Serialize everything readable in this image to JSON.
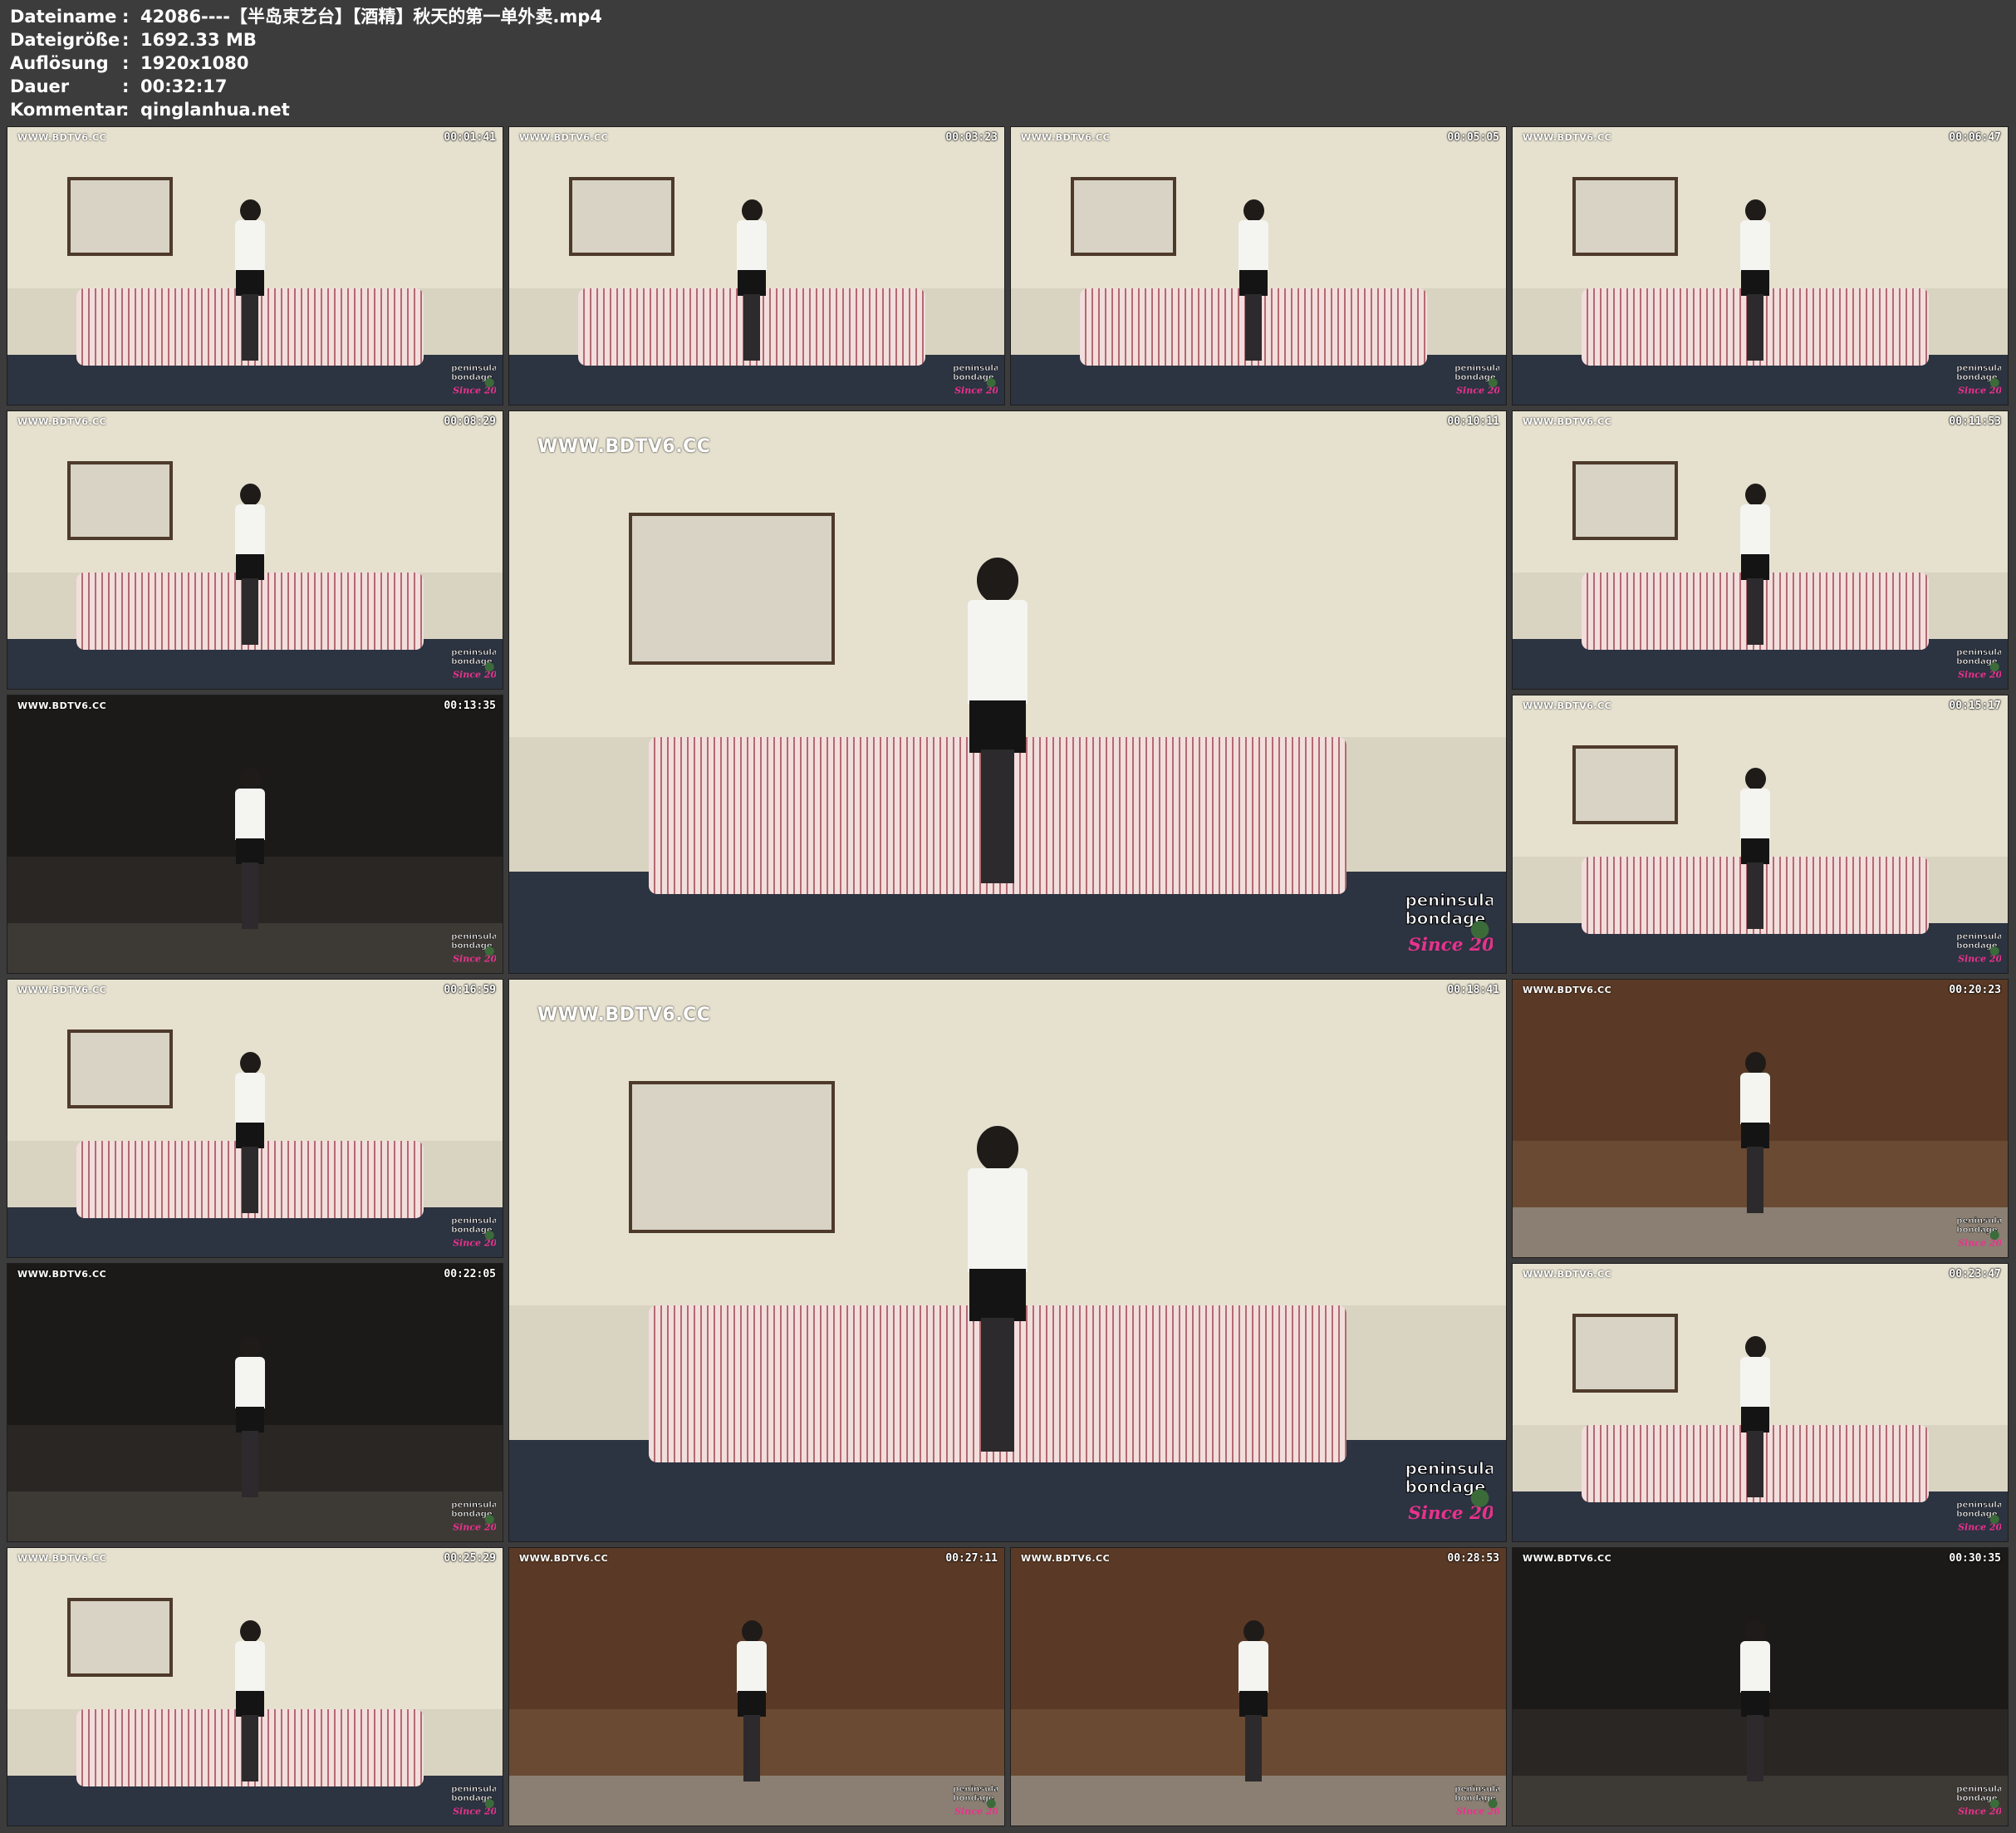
{
  "info": {
    "rows": [
      {
        "label": "Dateiname",
        "sep": ":",
        "value": "42086----【半岛束艺台】【酒精】秋天的第一单外卖.mp4"
      },
      {
        "label": "Dateigröße",
        "sep": ":",
        "value": "1692.33 MB"
      },
      {
        "label": "Auflösung",
        "sep": ":",
        "value": "1920x1080"
      },
      {
        "label": "Dauer",
        "sep": ":",
        "value": "00:32:17"
      },
      {
        "label": "Kommentar",
        "sep": ":",
        "value": "qinglanhua.net"
      }
    ]
  },
  "watermark": "WWW.BDTV6.CC",
  "thumbnails": [
    {
      "timestamp": "00:01:41",
      "scene": "living-room",
      "large": false
    },
    {
      "timestamp": "00:03:23",
      "scene": "living-room",
      "large": false
    },
    {
      "timestamp": "00:05:05",
      "scene": "living-room",
      "large": false
    },
    {
      "timestamp": "00:06:47",
      "scene": "living-room",
      "large": false
    },
    {
      "timestamp": "00:08:29",
      "scene": "living-room",
      "large": false
    },
    {
      "timestamp": "00:10:11",
      "scene": "living-room",
      "large": true
    },
    {
      "timestamp": "00:11:53",
      "scene": "living-room",
      "large": false
    },
    {
      "timestamp": "00:13:35",
      "scene": "outdoor",
      "large": false
    },
    {
      "timestamp": "00:15:17",
      "scene": "living-room",
      "large": false
    },
    {
      "timestamp": "00:16:59",
      "scene": "living-room",
      "large": false
    },
    {
      "timestamp": "00:18:41",
      "scene": "living-room",
      "large": true
    },
    {
      "timestamp": "00:20:23",
      "scene": "door",
      "large": false
    },
    {
      "timestamp": "00:22:05",
      "scene": "outdoor",
      "large": false
    },
    {
      "timestamp": "00:23:47",
      "scene": "living-room",
      "large": false
    },
    {
      "timestamp": "00:25:29",
      "scene": "living-room",
      "large": false
    },
    {
      "timestamp": "00:27:11",
      "scene": "door",
      "large": false
    },
    {
      "timestamp": "00:28:53",
      "scene": "door",
      "large": false
    },
    {
      "timestamp": "00:30:35",
      "scene": "outdoor",
      "large": false
    }
  ],
  "logo_name": "peninsula-bondage-logo"
}
